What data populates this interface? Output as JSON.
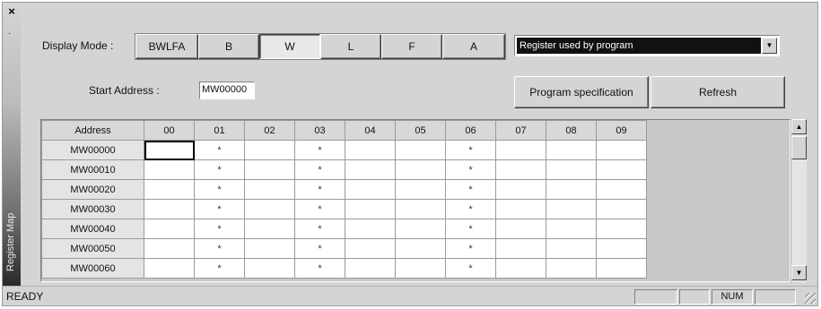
{
  "sidebar": {
    "close_symbol": "×",
    "pin_symbol": "·",
    "title": "Register Map"
  },
  "display_mode": {
    "label": "Display Mode :",
    "buttons": [
      {
        "label": "BWLFA"
      },
      {
        "label": "B"
      },
      {
        "label": "W",
        "active": true
      },
      {
        "label": "L"
      },
      {
        "label": "F"
      },
      {
        "label": "A"
      }
    ]
  },
  "register_filter": {
    "selected": "Register used by program",
    "arrow_icon": "chevron-down-icon"
  },
  "start_address": {
    "label": "Start Address :",
    "value": "MW00000"
  },
  "actions": {
    "program_specification": "Program specification",
    "refresh": "Refresh"
  },
  "grid": {
    "corner_header": "Address",
    "columns": [
      "00",
      "01",
      "02",
      "03",
      "04",
      "05",
      "06",
      "07",
      "08",
      "09"
    ],
    "rows": [
      {
        "address": "MW00000",
        "cells": [
          "",
          "*",
          "",
          "*",
          "",
          "",
          "*",
          "",
          "",
          ""
        ]
      },
      {
        "address": "MW00010",
        "cells": [
          "",
          "*",
          "",
          "*",
          "",
          "",
          "*",
          "",
          "",
          ""
        ]
      },
      {
        "address": "MW00020",
        "cells": [
          "",
          "*",
          "",
          "*",
          "",
          "",
          "*",
          "",
          "",
          ""
        ]
      },
      {
        "address": "MW00030",
        "cells": [
          "",
          "*",
          "",
          "*",
          "",
          "",
          "*",
          "",
          "",
          ""
        ]
      },
      {
        "address": "MW00040",
        "cells": [
          "",
          "*",
          "",
          "*",
          "",
          "",
          "*",
          "",
          "",
          ""
        ]
      },
      {
        "address": "MW00050",
        "cells": [
          "",
          "*",
          "",
          "*",
          "",
          "",
          "*",
          "",
          "",
          ""
        ]
      },
      {
        "address": "MW00060",
        "cells": [
          "",
          "*",
          "",
          "*",
          "",
          "",
          "*",
          "",
          "",
          ""
        ]
      }
    ]
  },
  "statusbar": {
    "status": "READY",
    "panels": [
      "",
      "",
      "NUM",
      ""
    ]
  }
}
